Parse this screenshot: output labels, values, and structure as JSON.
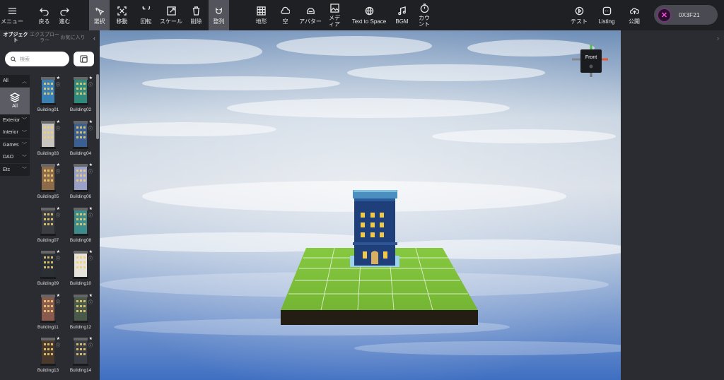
{
  "toolbar": {
    "menu": "メニュー",
    "undo": "戻る",
    "redo": "進む",
    "select": "選択",
    "move": "移動",
    "rotate": "回転",
    "scale": "スケール",
    "delete": "削除",
    "align": "整列",
    "terrain": "地形",
    "sky": "空",
    "avatar": "アバター",
    "media": "メディア",
    "text_to_space": "Text to Space",
    "bgm": "BGM",
    "countdown": "カウント",
    "test": "テスト",
    "listing": "Listing",
    "publish": "公開"
  },
  "wallet": {
    "address": "0X3F21"
  },
  "panel": {
    "tabs": [
      "オブジェクト",
      "エクスプローラー",
      "お気に入り"
    ],
    "search_placeholder": "検索",
    "categories": [
      "All",
      "Exterior",
      "Interior",
      "Games",
      "DAO",
      "Etc"
    ],
    "category_all_label": "All",
    "items": [
      {
        "name": "Building01",
        "color": "#3a7fb3"
      },
      {
        "name": "Building02",
        "color": "#2f8a7c"
      },
      {
        "name": "Building03",
        "color": "#c8c4bf"
      },
      {
        "name": "Building04",
        "color": "#3b5f91"
      },
      {
        "name": "Building05",
        "color": "#8c6a4a"
      },
      {
        "name": "Building06",
        "color": "#9aa0c8"
      },
      {
        "name": "Building07",
        "color": "#3a3d42"
      },
      {
        "name": "Building08",
        "color": "#3c8c8c"
      },
      {
        "name": "Building09",
        "color": "#2b2f36"
      },
      {
        "name": "Building10",
        "color": "#e6e2dc"
      },
      {
        "name": "Building11",
        "color": "#8a5a4e"
      },
      {
        "name": "Building12",
        "color": "#4a5a4a"
      },
      {
        "name": "Building13",
        "color": "#4a3a2e"
      },
      {
        "name": "Building14",
        "color": "#3a3d44"
      }
    ]
  },
  "viewport": {
    "gizmo_label": "Front"
  },
  "colors": {
    "toolbar_bg": "#1f2024",
    "panel_bg": "#2b2c31",
    "active_tool": "#54555c",
    "grass": "#7fc23d",
    "building": "#1f3f7a"
  }
}
